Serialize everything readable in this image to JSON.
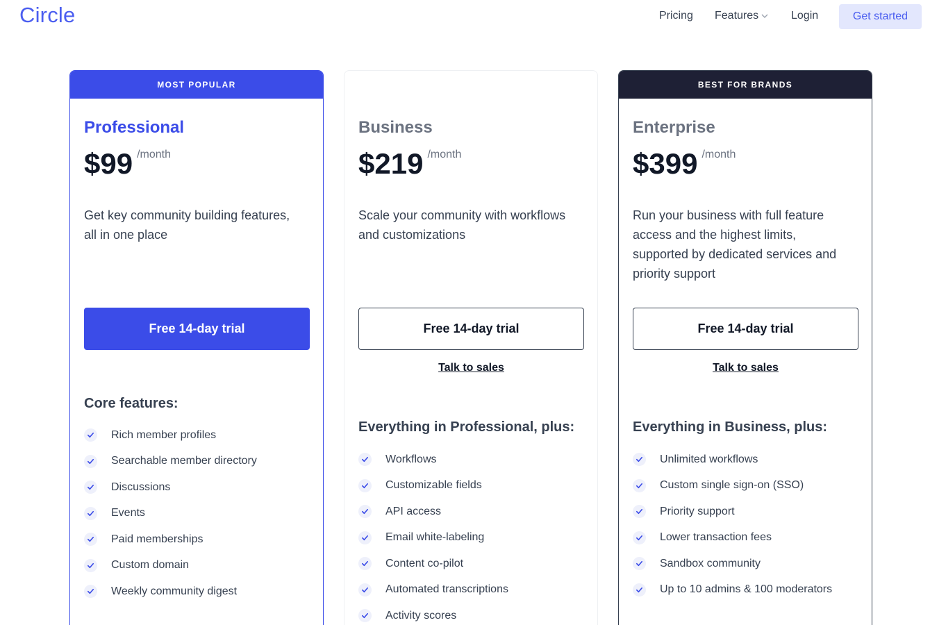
{
  "nav": {
    "logo": "Circle",
    "pricing": "Pricing",
    "features": "Features",
    "login": "Login",
    "get_started": "Get started"
  },
  "plans": [
    {
      "ribbon": "MOST POPULAR",
      "name": "Professional",
      "price": "$99",
      "period": "/month",
      "description": "Get key community building features, all in one place",
      "cta": "Free 14-day trial",
      "features_title": "Core features:",
      "features": [
        "Rich member profiles",
        "Searchable member directory",
        "Discussions",
        "Events",
        "Paid memberships",
        "Custom domain",
        "Weekly community digest"
      ]
    },
    {
      "ribbon": "",
      "name": "Business",
      "price": "$219",
      "period": "/month",
      "description": "Scale your community with workflows and customizations",
      "cta": "Free 14-day trial",
      "talk": "Talk to sales",
      "features_title": "Everything in Professional, plus:",
      "features": [
        "Workflows",
        "Customizable fields",
        "API access",
        "Email white-labeling",
        "Content co-pilot",
        "Automated transcriptions",
        "Activity scores"
      ]
    },
    {
      "ribbon": "BEST FOR BRANDS",
      "name": "Enterprise",
      "price": "$399",
      "period": "/month",
      "description": "Run your business with full feature access and the highest limits, supported by dedicated services and priority support",
      "cta": "Free 14-day trial",
      "talk": "Talk to sales",
      "features_title": "Everything in Business, plus:",
      "features": [
        "Unlimited workflows",
        "Custom single sign-on (SSO)",
        "Priority support",
        "Lower transaction fees",
        "Sandbox community",
        "Up to 10 admins & 100 moderators"
      ]
    }
  ],
  "colors": {
    "accent": "#3b4ce8",
    "dark": "#1e2035",
    "check_bg": "#eef0fb"
  },
  "icons": {
    "features_toggle": "chevron-down-icon",
    "feature_check": "check-icon"
  }
}
